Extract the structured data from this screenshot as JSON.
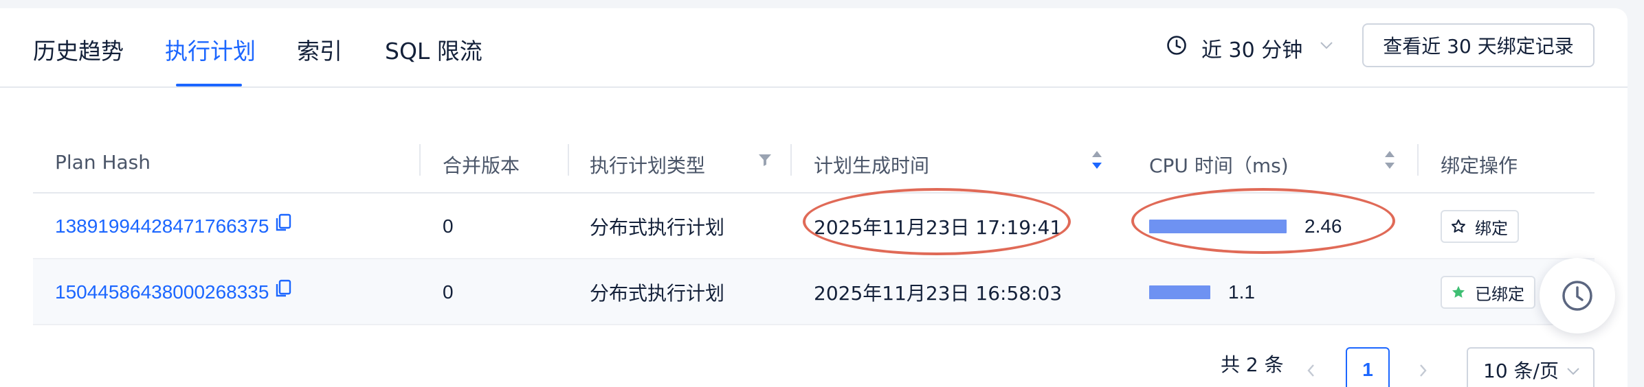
{
  "tabs": [
    {
      "label": "历史趋势",
      "active": false
    },
    {
      "label": "执行计划",
      "active": true
    },
    {
      "label": "索引",
      "active": false
    },
    {
      "label": "SQL 限流",
      "active": false
    }
  ],
  "toolbar": {
    "time_range": "近 30 分钟",
    "bind_history_button": "查看近 30 天绑定记录"
  },
  "table": {
    "columns": [
      "Plan Hash",
      "合并版本",
      "执行计划类型",
      "计划生成时间",
      "CPU 时间（ms)",
      "绑定操作"
    ],
    "rows": [
      {
        "plan_hash": "13891994428471766375",
        "merge_version": "0",
        "plan_type": "分布式执行计划",
        "generated_time": "2025年11月23日 17:19:41",
        "cpu_time": "2.46",
        "cpu_fraction": 1.0,
        "bind_label": "绑定",
        "bound": false
      },
      {
        "plan_hash": "15044586438000268335",
        "merge_version": "0",
        "plan_type": "分布式执行计划",
        "generated_time": "2025年11月23日 16:58:03",
        "cpu_time": "1.1",
        "cpu_fraction": 0.447,
        "bind_label": "已绑定",
        "bound": true
      }
    ]
  },
  "pagination": {
    "total": "共 2 条",
    "current_page": "1",
    "page_size": "10 条/页"
  },
  "colors": {
    "accent": "#1b66ff",
    "bar": "#6e92f2",
    "annotation": "#e06a57",
    "bound_star": "#3fbf73"
  }
}
